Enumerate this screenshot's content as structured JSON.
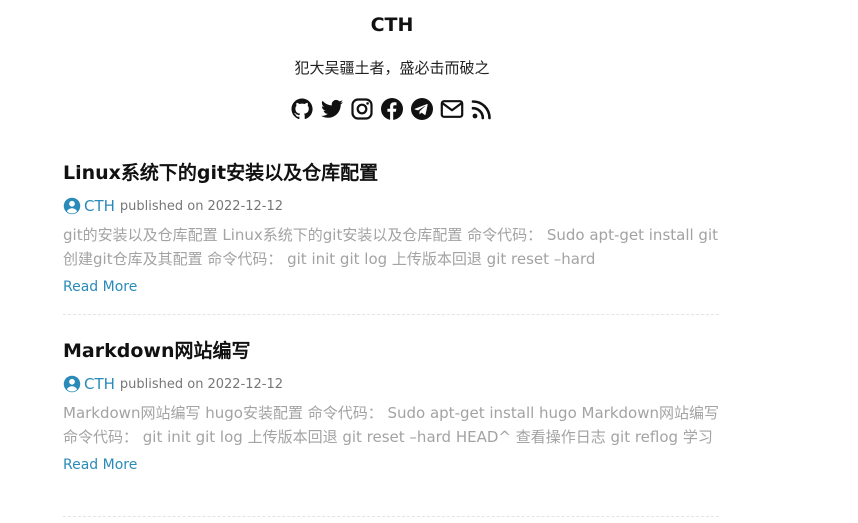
{
  "site": {
    "title": "CTH",
    "tagline": "犯大吴疆土者，盛必击而破之"
  },
  "social": [
    {
      "name": "github-icon"
    },
    {
      "name": "twitter-icon"
    },
    {
      "name": "instagram-icon"
    },
    {
      "name": "facebook-icon"
    },
    {
      "name": "telegram-icon"
    },
    {
      "name": "email-icon"
    },
    {
      "name": "rss-icon"
    }
  ],
  "posts": [
    {
      "title": "Linux系统下的git安装以及仓库配置",
      "author": "CTH",
      "published_label": "published on",
      "date": "2022-12-12",
      "summary": "git的安装以及仓库配置 Linux系统下的git安装以及仓库配置 命令代码： Sudo apt-get install git 创建git仓库及其配置 命令代码： git init git log 上传版本回退 git reset –hard",
      "read_more": "Read More"
    },
    {
      "title": "Markdown网站编写",
      "author": "CTH",
      "published_label": "published on",
      "date": "2022-12-12",
      "summary": "Markdown网站编写 hugo安装配置 命令代码： Sudo apt-get install hugo Markdown网站编写 命令代码： git init git log 上传版本回退 git reset –hard HEAD^ 查看操作日志 git reflog 学习",
      "read_more": "Read More"
    }
  ],
  "colors": {
    "link": "#2a8bb8",
    "summary_text": "#a3a3a3",
    "meta_text": "#777777"
  }
}
